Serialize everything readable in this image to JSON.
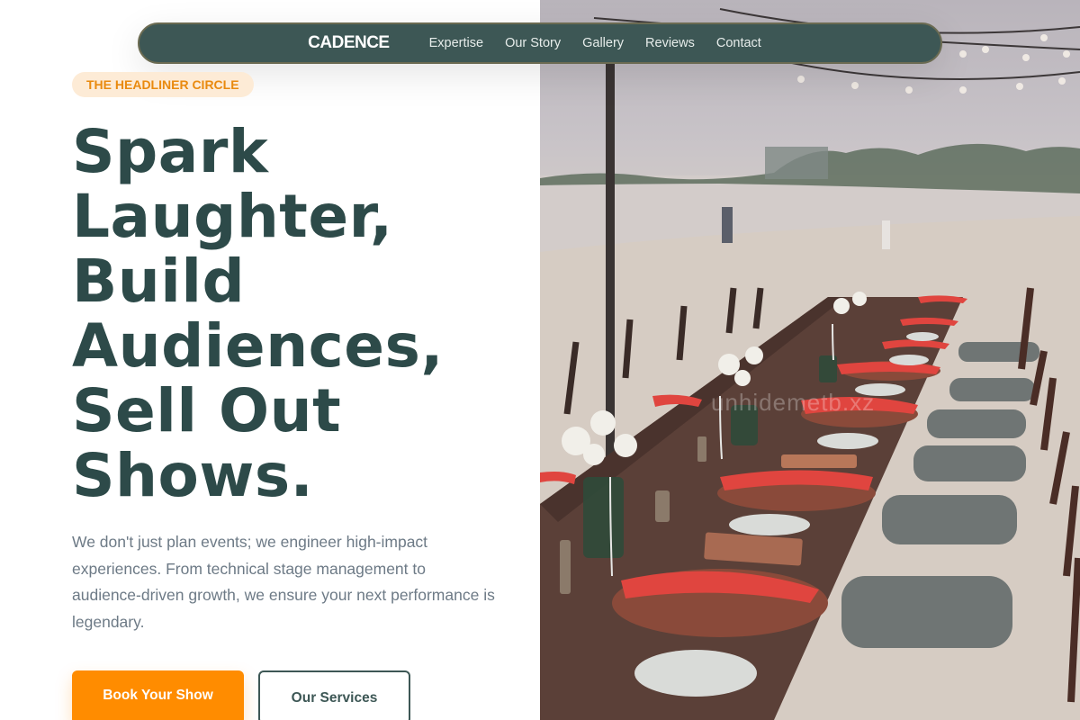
{
  "nav": {
    "brand": "CADENCE",
    "links": [
      "Expertise",
      "Our Story",
      "Gallery",
      "Reviews",
      "Contact"
    ]
  },
  "hero": {
    "badge": "THE HEADLINER CIRCLE",
    "headline_lines": [
      "Spark",
      "Laughter,",
      "Build",
      "Audiences,",
      "Sell Out",
      "Shows."
    ],
    "description": "We don't just plan events; we engineer high-impact experiences. From technical stage management to audience-driven growth, we ensure your next performance is legendary.",
    "primary_cta": "Book Your Show",
    "secondary_cta": "Our Services"
  },
  "image": {
    "watermark": "unhidemetb.xz"
  },
  "colors": {
    "brand_dark": "#3d5755",
    "headline": "#2d4a49",
    "accent": "#ff8c00",
    "badge_bg": "#fdebd6",
    "badge_text": "#e98a0f",
    "body_text": "#6d7a86"
  }
}
